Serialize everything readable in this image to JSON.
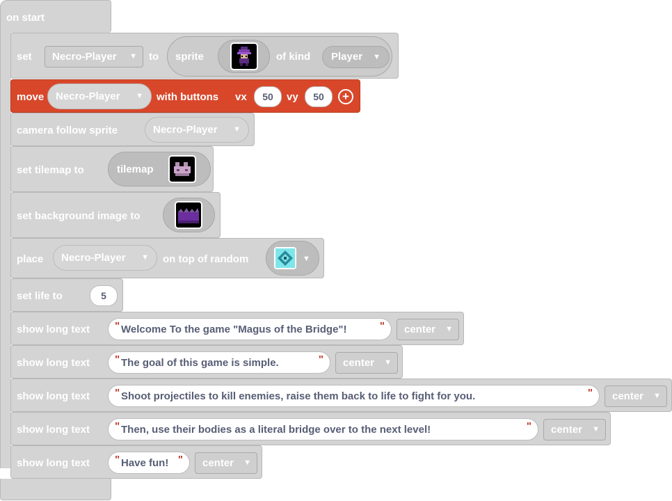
{
  "event": {
    "label": "on start"
  },
  "set_sprite": {
    "set_label": "set",
    "variable": "Necro-Player",
    "to_label": "to",
    "sprite_label": "sprite",
    "of_kind_label": "of kind",
    "kind": "Player"
  },
  "move": {
    "move_label": "move",
    "sprite": "Necro-Player",
    "with_buttons_label": "with buttons",
    "vx_label": "vx",
    "vx": "50",
    "vy_label": "vy",
    "vy": "50"
  },
  "camera": {
    "label": "camera follow sprite",
    "sprite": "Necro-Player"
  },
  "tilemap": {
    "label": "set tilemap to",
    "value_label": "tilemap"
  },
  "background": {
    "label": "set background image to"
  },
  "place": {
    "place_label": "place",
    "sprite": "Necro-Player",
    "on_top_label": "on top of random"
  },
  "life": {
    "label": "set life to",
    "value": "5"
  },
  "long_texts": [
    {
      "label": "show long text",
      "text": "Welcome To the game \"Magus of the Bridge\"!",
      "align": "center"
    },
    {
      "label": "show long text",
      "text": "The goal of this game is simple.",
      "align": "center"
    },
    {
      "label": "show long text",
      "text": "Shoot projectiles to kill enemies, raise them back to life to fight for you.",
      "align": "center"
    },
    {
      "label": "show long text",
      "text": "Then, use their bodies as a literal bridge over to the next level!",
      "align": "center"
    },
    {
      "label": "show long text",
      "text": "Have fun!",
      "align": "center"
    }
  ],
  "icons": {
    "dropdown": "chevron-down-icon",
    "quote": "quote-mark-icon",
    "add": "plus-circle-icon"
  },
  "colors": {
    "block_gray": "#d4d4d4",
    "move_block_red": "#d9472b",
    "quote_red": "#c0392b",
    "field_text": "#575e75"
  }
}
